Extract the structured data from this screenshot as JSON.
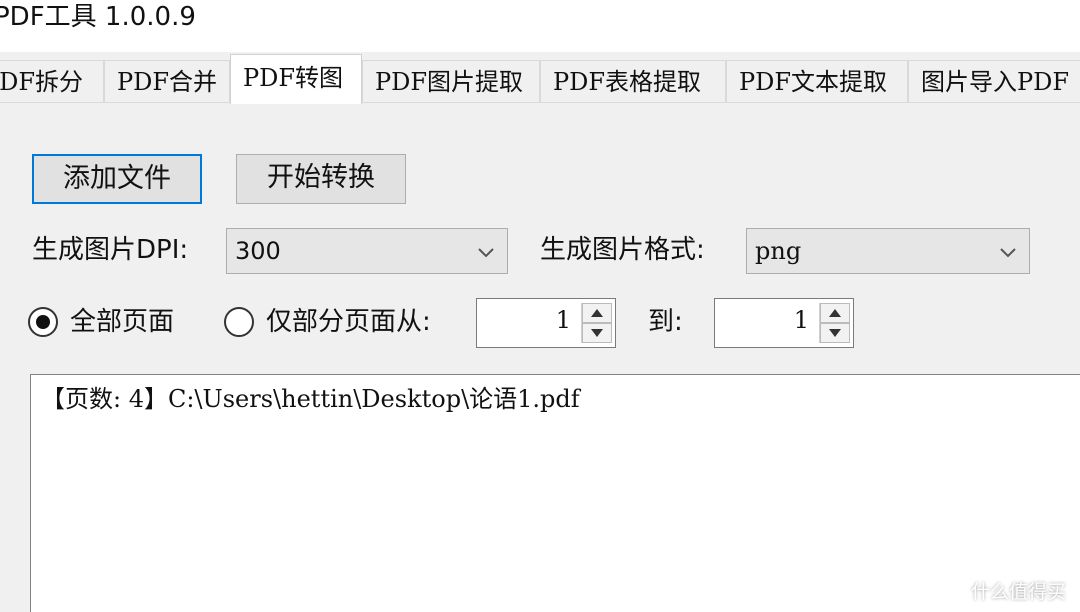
{
  "window": {
    "title": "PDF工具 1.0.0.9"
  },
  "tabs": [
    {
      "label": "PDF拆分",
      "active": false
    },
    {
      "label": "PDF合并",
      "active": false
    },
    {
      "label": "PDF转图",
      "active": true
    },
    {
      "label": "PDF图片提取",
      "active": false
    },
    {
      "label": "PDF表格提取",
      "active": false
    },
    {
      "label": "PDF文本提取",
      "active": false
    },
    {
      "label": "图片导入PDF",
      "active": false
    }
  ],
  "buttons": {
    "add_file": "添加文件",
    "start_convert": "开始转换"
  },
  "dpi": {
    "label": "生成图片DPI:",
    "value": "300"
  },
  "format": {
    "label": "生成图片格式:",
    "value": "png"
  },
  "page_range": {
    "all_label": "全部页面",
    "all_selected": true,
    "partial_label": "仅部分页面从:",
    "partial_selected": false,
    "from_value": "1",
    "to_label": "到:",
    "to_value": "1"
  },
  "file_list": {
    "lines": [
      "【页数: 4】C:\\Users\\hettin\\Desktop\\论语1.pdf"
    ]
  },
  "watermark": {
    "text": "什么值得买",
    "icon_glyph": "值"
  },
  "colors": {
    "focus_border": "#0078d7",
    "panel_bg": "#f0f0f0",
    "button_bg": "#e1e1e1"
  }
}
